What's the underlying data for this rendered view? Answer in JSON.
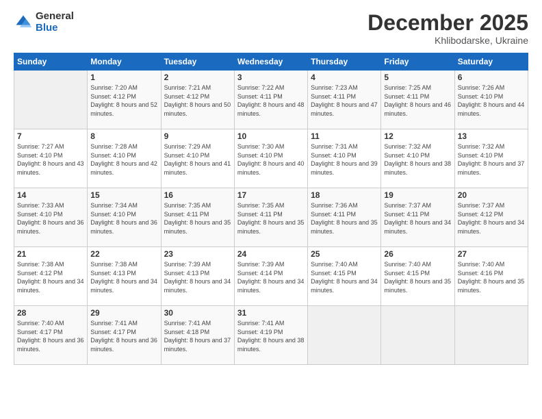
{
  "logo": {
    "general": "General",
    "blue": "Blue"
  },
  "header": {
    "month": "December 2025",
    "location": "Khlibodarske, Ukraine"
  },
  "weekdays": [
    "Sunday",
    "Monday",
    "Tuesday",
    "Wednesday",
    "Thursday",
    "Friday",
    "Saturday"
  ],
  "weeks": [
    [
      {
        "day": "",
        "sunrise": "",
        "sunset": "",
        "daylight": ""
      },
      {
        "day": "1",
        "sunrise": "Sunrise: 7:20 AM",
        "sunset": "Sunset: 4:12 PM",
        "daylight": "Daylight: 8 hours and 52 minutes."
      },
      {
        "day": "2",
        "sunrise": "Sunrise: 7:21 AM",
        "sunset": "Sunset: 4:12 PM",
        "daylight": "Daylight: 8 hours and 50 minutes."
      },
      {
        "day": "3",
        "sunrise": "Sunrise: 7:22 AM",
        "sunset": "Sunset: 4:11 PM",
        "daylight": "Daylight: 8 hours and 48 minutes."
      },
      {
        "day": "4",
        "sunrise": "Sunrise: 7:23 AM",
        "sunset": "Sunset: 4:11 PM",
        "daylight": "Daylight: 8 hours and 47 minutes."
      },
      {
        "day": "5",
        "sunrise": "Sunrise: 7:25 AM",
        "sunset": "Sunset: 4:11 PM",
        "daylight": "Daylight: 8 hours and 46 minutes."
      },
      {
        "day": "6",
        "sunrise": "Sunrise: 7:26 AM",
        "sunset": "Sunset: 4:10 PM",
        "daylight": "Daylight: 8 hours and 44 minutes."
      }
    ],
    [
      {
        "day": "7",
        "sunrise": "Sunrise: 7:27 AM",
        "sunset": "Sunset: 4:10 PM",
        "daylight": "Daylight: 8 hours and 43 minutes."
      },
      {
        "day": "8",
        "sunrise": "Sunrise: 7:28 AM",
        "sunset": "Sunset: 4:10 PM",
        "daylight": "Daylight: 8 hours and 42 minutes."
      },
      {
        "day": "9",
        "sunrise": "Sunrise: 7:29 AM",
        "sunset": "Sunset: 4:10 PM",
        "daylight": "Daylight: 8 hours and 41 minutes."
      },
      {
        "day": "10",
        "sunrise": "Sunrise: 7:30 AM",
        "sunset": "Sunset: 4:10 PM",
        "daylight": "Daylight: 8 hours and 40 minutes."
      },
      {
        "day": "11",
        "sunrise": "Sunrise: 7:31 AM",
        "sunset": "Sunset: 4:10 PM",
        "daylight": "Daylight: 8 hours and 39 minutes."
      },
      {
        "day": "12",
        "sunrise": "Sunrise: 7:32 AM",
        "sunset": "Sunset: 4:10 PM",
        "daylight": "Daylight: 8 hours and 38 minutes."
      },
      {
        "day": "13",
        "sunrise": "Sunrise: 7:32 AM",
        "sunset": "Sunset: 4:10 PM",
        "daylight": "Daylight: 8 hours and 37 minutes."
      }
    ],
    [
      {
        "day": "14",
        "sunrise": "Sunrise: 7:33 AM",
        "sunset": "Sunset: 4:10 PM",
        "daylight": "Daylight: 8 hours and 36 minutes."
      },
      {
        "day": "15",
        "sunrise": "Sunrise: 7:34 AM",
        "sunset": "Sunset: 4:10 PM",
        "daylight": "Daylight: 8 hours and 36 minutes."
      },
      {
        "day": "16",
        "sunrise": "Sunrise: 7:35 AM",
        "sunset": "Sunset: 4:11 PM",
        "daylight": "Daylight: 8 hours and 35 minutes."
      },
      {
        "day": "17",
        "sunrise": "Sunrise: 7:35 AM",
        "sunset": "Sunset: 4:11 PM",
        "daylight": "Daylight: 8 hours and 35 minutes."
      },
      {
        "day": "18",
        "sunrise": "Sunrise: 7:36 AM",
        "sunset": "Sunset: 4:11 PM",
        "daylight": "Daylight: 8 hours and 35 minutes."
      },
      {
        "day": "19",
        "sunrise": "Sunrise: 7:37 AM",
        "sunset": "Sunset: 4:11 PM",
        "daylight": "Daylight: 8 hours and 34 minutes."
      },
      {
        "day": "20",
        "sunrise": "Sunrise: 7:37 AM",
        "sunset": "Sunset: 4:12 PM",
        "daylight": "Daylight: 8 hours and 34 minutes."
      }
    ],
    [
      {
        "day": "21",
        "sunrise": "Sunrise: 7:38 AM",
        "sunset": "Sunset: 4:12 PM",
        "daylight": "Daylight: 8 hours and 34 minutes."
      },
      {
        "day": "22",
        "sunrise": "Sunrise: 7:38 AM",
        "sunset": "Sunset: 4:13 PM",
        "daylight": "Daylight: 8 hours and 34 minutes."
      },
      {
        "day": "23",
        "sunrise": "Sunrise: 7:39 AM",
        "sunset": "Sunset: 4:13 PM",
        "daylight": "Daylight: 8 hours and 34 minutes."
      },
      {
        "day": "24",
        "sunrise": "Sunrise: 7:39 AM",
        "sunset": "Sunset: 4:14 PM",
        "daylight": "Daylight: 8 hours and 34 minutes."
      },
      {
        "day": "25",
        "sunrise": "Sunrise: 7:40 AM",
        "sunset": "Sunset: 4:15 PM",
        "daylight": "Daylight: 8 hours and 34 minutes."
      },
      {
        "day": "26",
        "sunrise": "Sunrise: 7:40 AM",
        "sunset": "Sunset: 4:15 PM",
        "daylight": "Daylight: 8 hours and 35 minutes."
      },
      {
        "day": "27",
        "sunrise": "Sunrise: 7:40 AM",
        "sunset": "Sunset: 4:16 PM",
        "daylight": "Daylight: 8 hours and 35 minutes."
      }
    ],
    [
      {
        "day": "28",
        "sunrise": "Sunrise: 7:40 AM",
        "sunset": "Sunset: 4:17 PM",
        "daylight": "Daylight: 8 hours and 36 minutes."
      },
      {
        "day": "29",
        "sunrise": "Sunrise: 7:41 AM",
        "sunset": "Sunset: 4:17 PM",
        "daylight": "Daylight: 8 hours and 36 minutes."
      },
      {
        "day": "30",
        "sunrise": "Sunrise: 7:41 AM",
        "sunset": "Sunset: 4:18 PM",
        "daylight": "Daylight: 8 hours and 37 minutes."
      },
      {
        "day": "31",
        "sunrise": "Sunrise: 7:41 AM",
        "sunset": "Sunset: 4:19 PM",
        "daylight": "Daylight: 8 hours and 38 minutes."
      },
      {
        "day": "",
        "sunrise": "",
        "sunset": "",
        "daylight": ""
      },
      {
        "day": "",
        "sunrise": "",
        "sunset": "",
        "daylight": ""
      },
      {
        "day": "",
        "sunrise": "",
        "sunset": "",
        "daylight": ""
      }
    ]
  ]
}
